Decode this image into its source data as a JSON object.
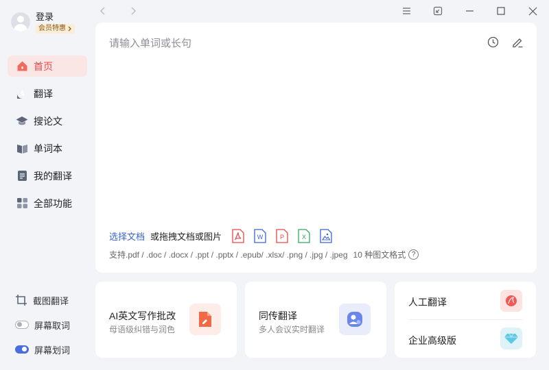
{
  "user": {
    "login_label": "登录",
    "vip_label": "会员特惠"
  },
  "nav": [
    {
      "label": "首页",
      "icon": "home-icon",
      "active": true
    },
    {
      "label": "翻译",
      "icon": "translate-icon",
      "active": false
    },
    {
      "label": "搜论文",
      "icon": "mortarboard-icon",
      "active": false
    },
    {
      "label": "单词本",
      "icon": "book-icon",
      "active": false
    },
    {
      "label": "我的翻译",
      "icon": "document-icon",
      "active": false
    },
    {
      "label": "全部功能",
      "icon": "grid-icon",
      "active": false
    }
  ],
  "tools": [
    {
      "label": "截图翻译",
      "icon": "crop-icon"
    },
    {
      "label": "屏幕取词",
      "toggle": false
    },
    {
      "label": "屏幕划词",
      "toggle": true
    }
  ],
  "main": {
    "input_placeholder": "请输入单词或长句",
    "choose_doc": "选择文档",
    "drag_text": "或拖拽文档或图片",
    "file_types": [
      {
        "icon": "pdf-icon",
        "letter": "",
        "color": "#e8484b"
      },
      {
        "icon": "word-icon",
        "letter": "W",
        "color": "#3a63d6"
      },
      {
        "icon": "ppt-icon",
        "letter": "P",
        "color": "#e8484b"
      },
      {
        "icon": "excel-icon",
        "letter": "X",
        "color": "#2eaa5c"
      },
      {
        "icon": "image-icon",
        "letter": "",
        "color": "#3a63d6"
      }
    ],
    "support_text": "支持.pdf / .doc / .docx / .ppt / .pptx / .epub/ .xlsx/ .png / .jpg / .jpeg",
    "formats_text": "10 种图文格式",
    "help_glyph": "?"
  },
  "cards": {
    "ai_writing": {
      "title": "AI英文写作批改",
      "subtitle": "母语级纠错与润色"
    },
    "simultaneous": {
      "title": "同传翻译",
      "subtitle": "多人会议实时翻译"
    },
    "human_translation": {
      "title": "人工翻译"
    },
    "enterprise": {
      "title": "企业高级版"
    }
  },
  "colors": {
    "accent_red": "#e8484b",
    "accent_blue": "#4a6ee0",
    "active_nav_bg": "#fbe6e6"
  }
}
